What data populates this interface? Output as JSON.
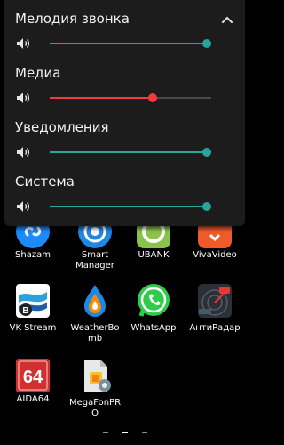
{
  "colors": {
    "panel_bg": "#1c1c1c",
    "accent": "#26a69a",
    "media_accent": "#ef3b3b",
    "text": "#f2f2f2"
  },
  "volume_panel": {
    "collapse_icon": "chevron-up-icon",
    "streams": [
      {
        "label": "Мелодия звонка",
        "level": 1.0,
        "icon": "speaker-icon"
      },
      {
        "label": "Медиа",
        "level": 0.64,
        "icon": "speaker-icon"
      },
      {
        "label": "Уведомления",
        "level": 1.0,
        "icon": "speaker-icon"
      },
      {
        "label": "Система",
        "level": 1.0,
        "icon": "speaker-icon"
      }
    ]
  },
  "home_screen": {
    "apps": [
      {
        "label": "Shazam",
        "icon": "shazam-icon"
      },
      {
        "label": "Smart Manager",
        "icon": "smart-manager-icon"
      },
      {
        "label": "UBANK",
        "icon": "ubank-icon"
      },
      {
        "label": "VivaVideo",
        "icon": "vivavideo-icon"
      },
      {
        "label": "VK Stream",
        "icon": "vk-stream-icon"
      },
      {
        "label": "WeatherBomb",
        "icon": "weatherbomb-icon"
      },
      {
        "label": "WhatsApp",
        "icon": "whatsapp-icon"
      },
      {
        "label": "АнтиРадар",
        "icon": "antiradar-icon"
      },
      {
        "label": "AIDA64",
        "icon": "aida64-icon"
      },
      {
        "label": "MegaFonPRO",
        "icon": "megafon-pro-icon"
      }
    ],
    "page_indicator": {
      "pages": 3,
      "current": 2
    }
  }
}
